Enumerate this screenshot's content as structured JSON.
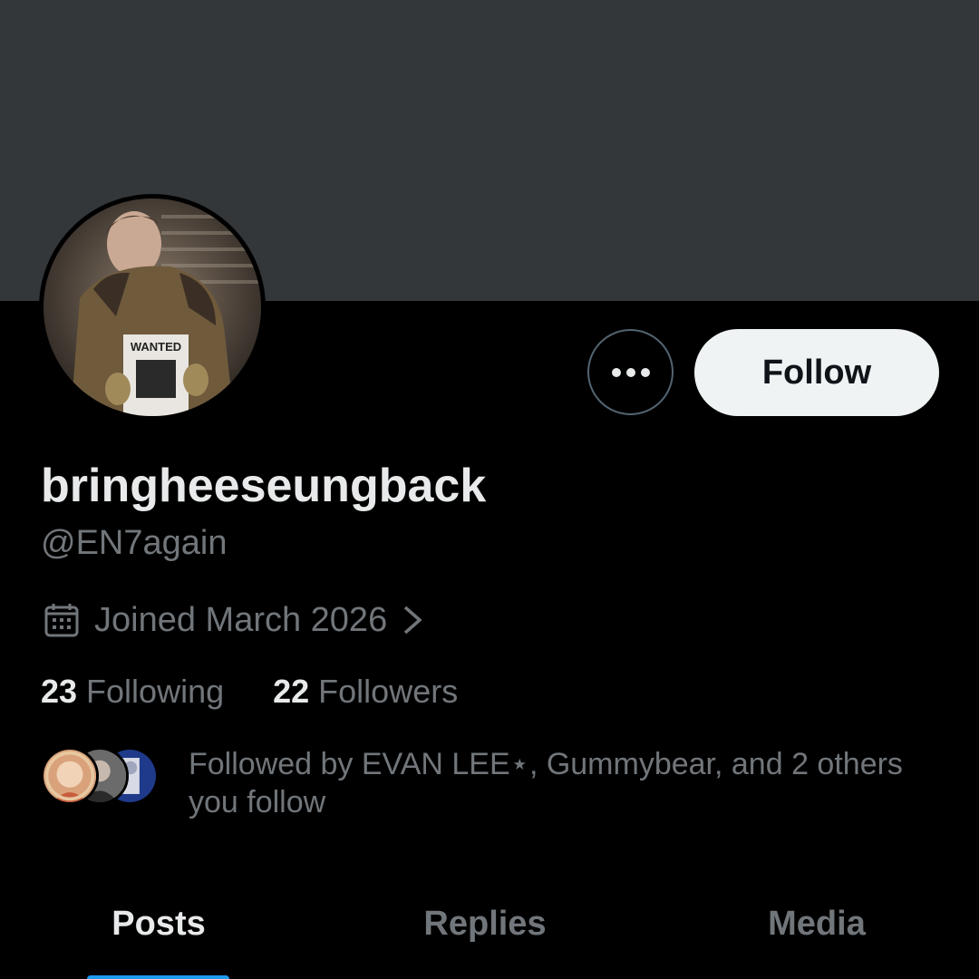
{
  "profile": {
    "display_name": "bringheeseungback",
    "handle": "@EN7again",
    "joined": "Joined March 2026",
    "avatar_poster_text": "WANTED"
  },
  "actions": {
    "more_icon": "ellipsis-icon",
    "follow_label": "Follow"
  },
  "stats": {
    "following_count": "23",
    "following_label": "Following",
    "followers_count": "22",
    "followers_label": "Followers"
  },
  "followed_by": {
    "prefix": "Followed by ",
    "name1": "EVAN LEE⋆",
    "middle": ", Gummybear, and 2 others you follow"
  },
  "tabs": [
    {
      "label": "Posts",
      "active": true
    },
    {
      "label": "Replies",
      "active": false
    },
    {
      "label": "Media",
      "active": false
    }
  ],
  "colors": {
    "background": "#000000",
    "banner": "#33373a",
    "primary_text": "#e7e9ea",
    "secondary_text": "#71767b",
    "follow_button_bg": "#eff3f4",
    "accent": "#1d9bf0"
  }
}
